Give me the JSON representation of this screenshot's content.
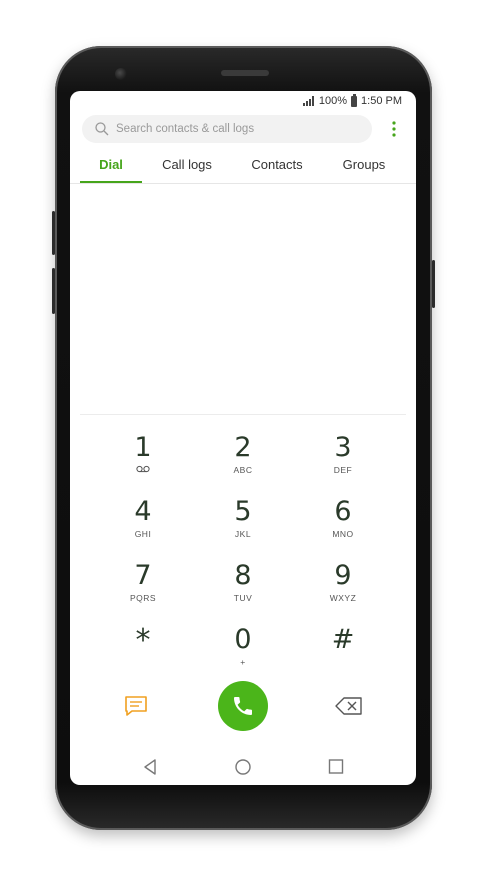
{
  "status": {
    "signal_icon": "signal-icon",
    "battery": "100%",
    "battery_icon": "battery-icon",
    "time": "1:50 PM"
  },
  "search": {
    "placeholder": "Search contacts & call logs",
    "icon": "search-icon"
  },
  "menu": {
    "icon": "more-vert-icon"
  },
  "tabs": [
    {
      "label": "Dial",
      "active": true
    },
    {
      "label": "Call logs",
      "active": false
    },
    {
      "label": "Contacts",
      "active": false
    },
    {
      "label": "Groups",
      "active": false
    }
  ],
  "keypad": [
    {
      "digit": "1",
      "letters": ""
    },
    {
      "digit": "2",
      "letters": "ABC"
    },
    {
      "digit": "3",
      "letters": "DEF"
    },
    {
      "digit": "4",
      "letters": "GHI"
    },
    {
      "digit": "5",
      "letters": "JKL"
    },
    {
      "digit": "6",
      "letters": "MNO"
    },
    {
      "digit": "7",
      "letters": "PQRS"
    },
    {
      "digit": "8",
      "letters": "TUV"
    },
    {
      "digit": "9",
      "letters": "WXYZ"
    },
    {
      "digit": "*",
      "letters": ""
    },
    {
      "digit": "0",
      "letters": "+"
    },
    {
      "digit": "#",
      "letters": ""
    }
  ],
  "actions": {
    "message_icon": "message-icon",
    "call_icon": "phone-icon",
    "backspace_icon": "backspace-icon"
  },
  "navigation": {
    "back_icon": "back-icon",
    "home_icon": "home-icon",
    "recents_icon": "recents-icon"
  },
  "colors": {
    "accent": "#46a51b",
    "call_button": "#4bb51a",
    "message_icon": "#f0a020"
  }
}
